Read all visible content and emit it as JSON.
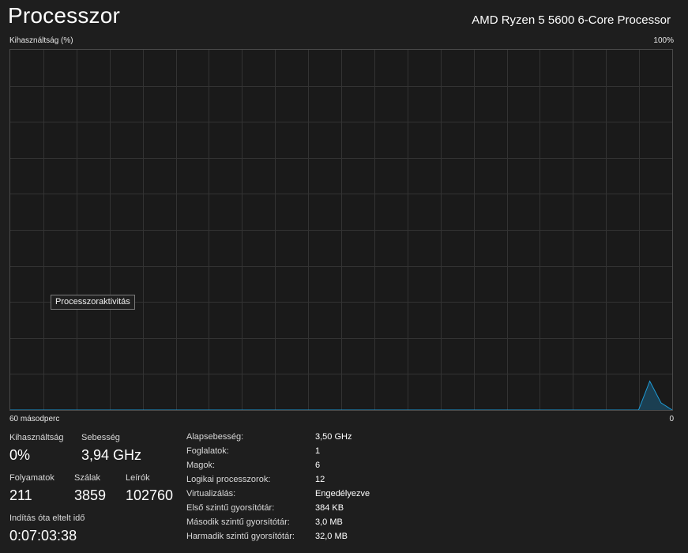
{
  "header": {
    "title": "Processzor",
    "cpu_name": "AMD Ryzen 5 5600 6-Core Processor"
  },
  "graph": {
    "y_label": "Kihasználtság (%)",
    "y_max_label": "100%",
    "x_left_label": "60 másodperc",
    "x_right_label": "0",
    "tooltip": "Processzoraktivitás",
    "line_color": "#1e9bd6",
    "fill_color": "#1b3f52",
    "grid_color": "#333333",
    "utilization_series": [
      0,
      0,
      0,
      0,
      0,
      0,
      0,
      0,
      0,
      0,
      0,
      0,
      0,
      0,
      0,
      0,
      0,
      0,
      0,
      0,
      0,
      0,
      0,
      0,
      0,
      0,
      0,
      0,
      0,
      0,
      0,
      0,
      0,
      0,
      0,
      0,
      0,
      0,
      0,
      0,
      0,
      0,
      0,
      0,
      0,
      0,
      0,
      0,
      0,
      0,
      0,
      0,
      0,
      0,
      0,
      0,
      0,
      8,
      2,
      0
    ]
  },
  "stats": {
    "utilization": {
      "label": "Kihasználtság",
      "value": "0%"
    },
    "speed": {
      "label": "Sebesség",
      "value": "3,94 GHz"
    },
    "processes": {
      "label": "Folyamatok",
      "value": "211"
    },
    "threads": {
      "label": "Szálak",
      "value": "3859"
    },
    "handles": {
      "label": "Leírók",
      "value": "102760"
    },
    "uptime": {
      "label": "Indítás óta eltelt idő",
      "value": "0:07:03:38"
    }
  },
  "specs": [
    {
      "key": "Alapsebesség:",
      "value": "3,50 GHz"
    },
    {
      "key": "Foglalatok:",
      "value": "1"
    },
    {
      "key": "Magok:",
      "value": "6"
    },
    {
      "key": "Logikai processzorok:",
      "value": "12"
    },
    {
      "key": "Virtualizálás:",
      "value": "Engedélyezve"
    },
    {
      "key": "Első szintű gyorsítótár:",
      "value": "384 KB"
    },
    {
      "key": "Második szintű gyorsítótár:",
      "value": "3,0 MB"
    },
    {
      "key": "Harmadik szintű gyorsítótár:",
      "value": "32,0 MB"
    }
  ]
}
